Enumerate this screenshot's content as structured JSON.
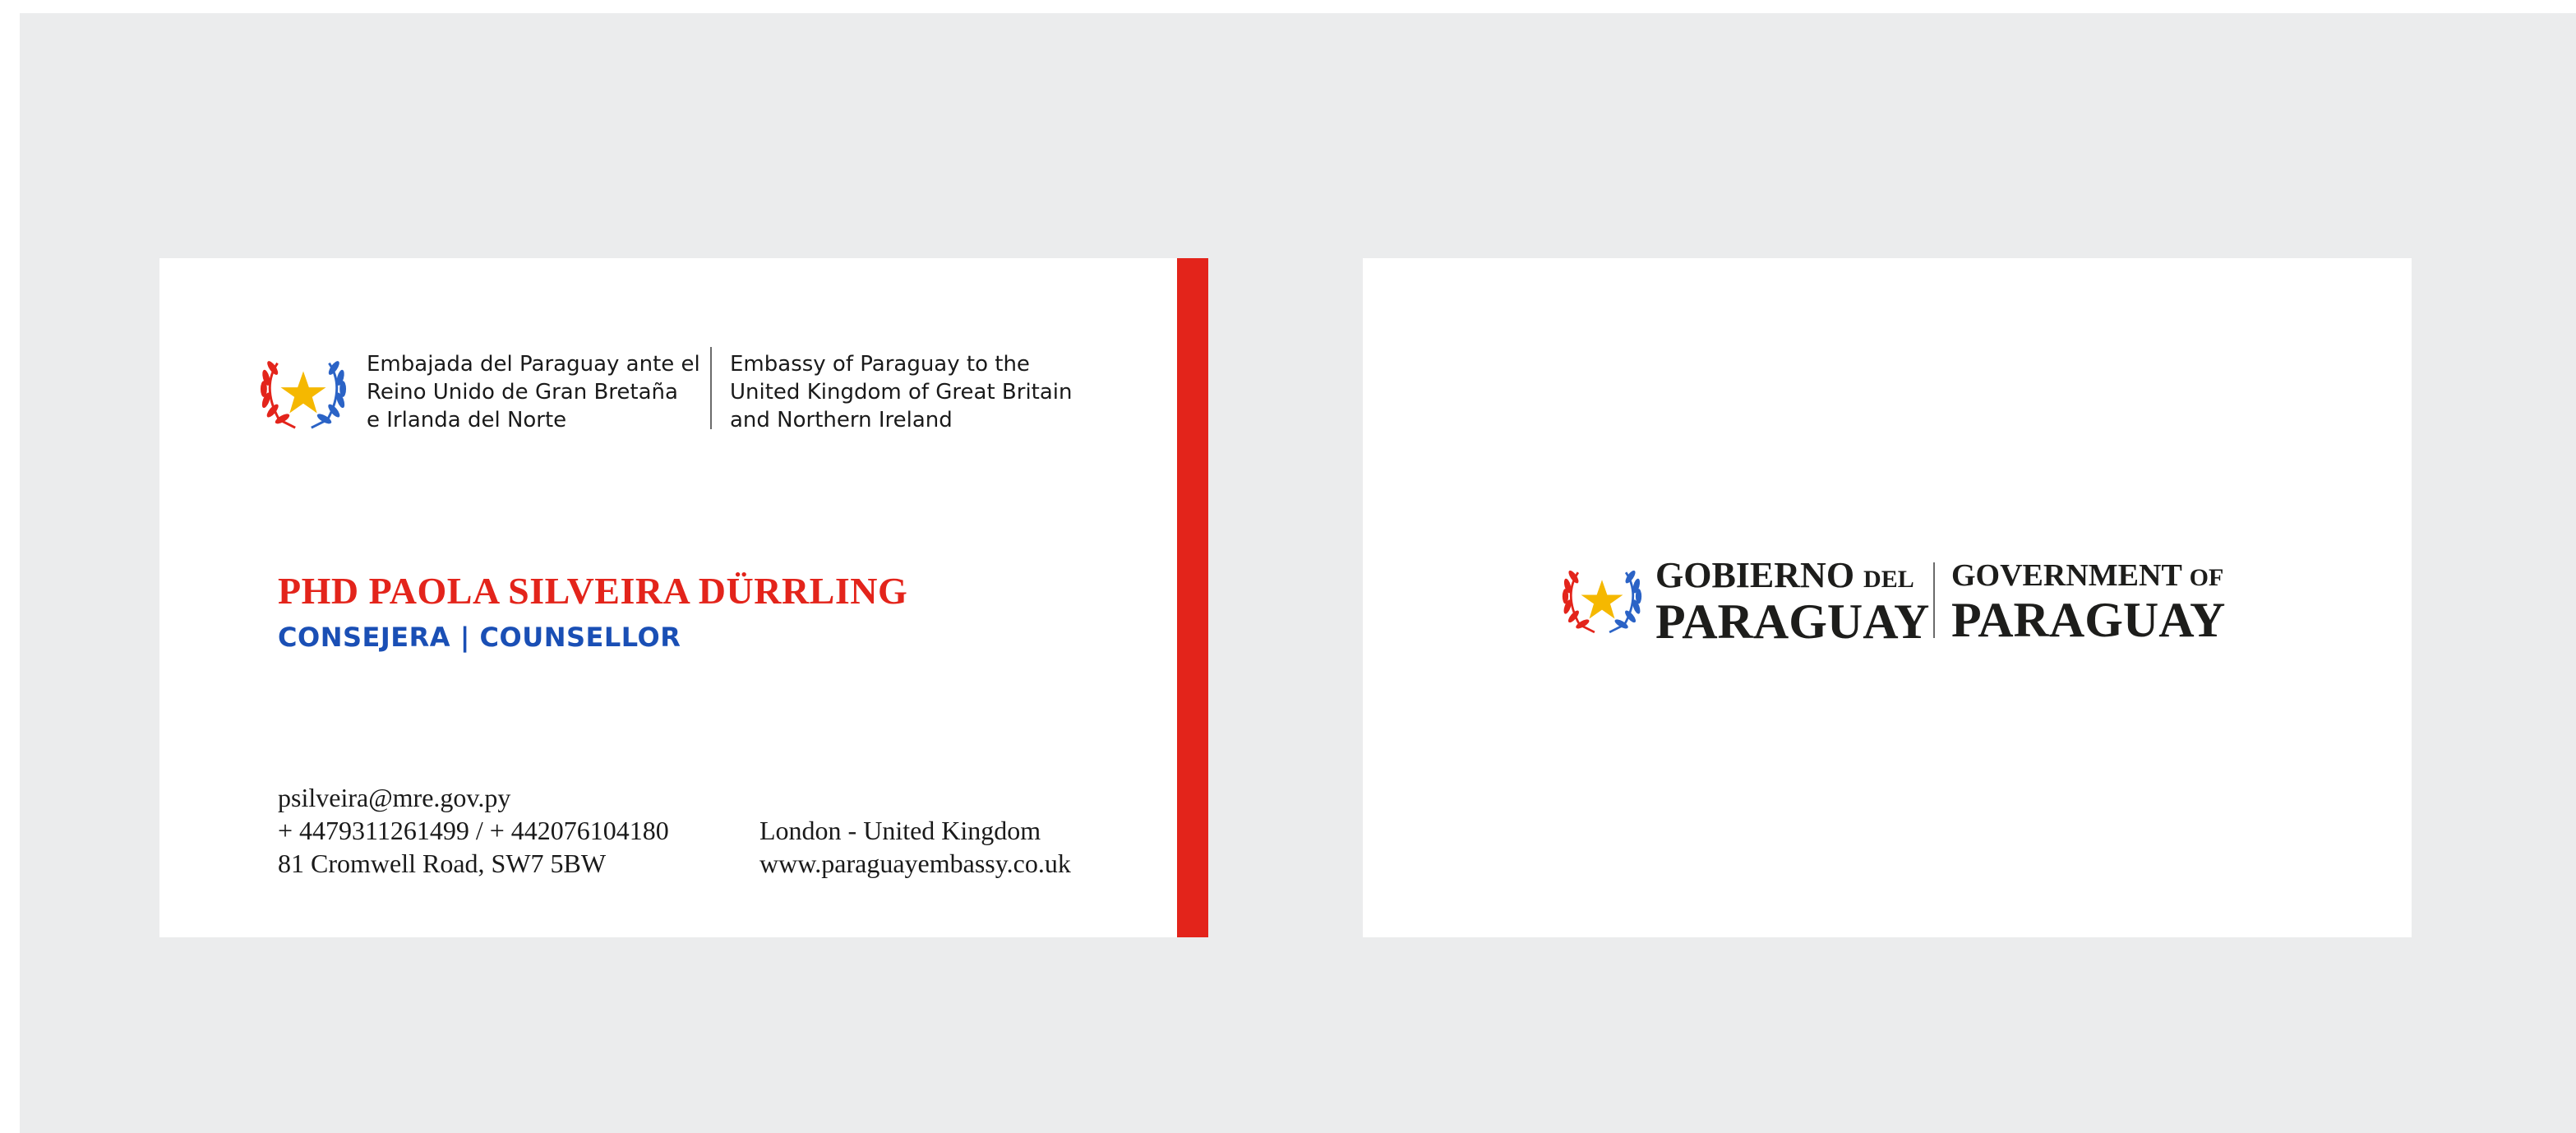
{
  "front": {
    "embassy_es": [
      "Embajada del Paraguay ante el",
      "Reino Unido de Gran Bretaña",
      "e Irlanda del Norte"
    ],
    "embassy_en": [
      "Embassy of Paraguay to the",
      "United Kingdom of Great Britain",
      "and Northern Ireland"
    ],
    "name": "PHD PAOLA SILVEIRA DÜRRLING",
    "title": "CONSEJERA | COUNSELLOR",
    "email": "psilveira@mre.gov.py",
    "phone": "+ 4479311261499 / + 442076104180",
    "address": "81 Cromwell Road, SW7 5BW",
    "city": "London - United Kingdom",
    "website": "www.paraguayembassy.co.uk"
  },
  "back": {
    "gov_es_word": "GOBIERNO",
    "gov_es_small": "DEL",
    "gov_es_country": "PARAGUAY",
    "gov_en_word": "GOVERNMENT",
    "gov_en_small": "OF",
    "gov_en_country": "PARAGUAY"
  },
  "colors": {
    "accent_red": "#e3241b",
    "accent_blue": "#1a4fb5",
    "star_yellow": "#f5b800",
    "background": "#ebeced"
  },
  "icons": {
    "emblem": "paraguay-coat-of-arms-icon"
  }
}
